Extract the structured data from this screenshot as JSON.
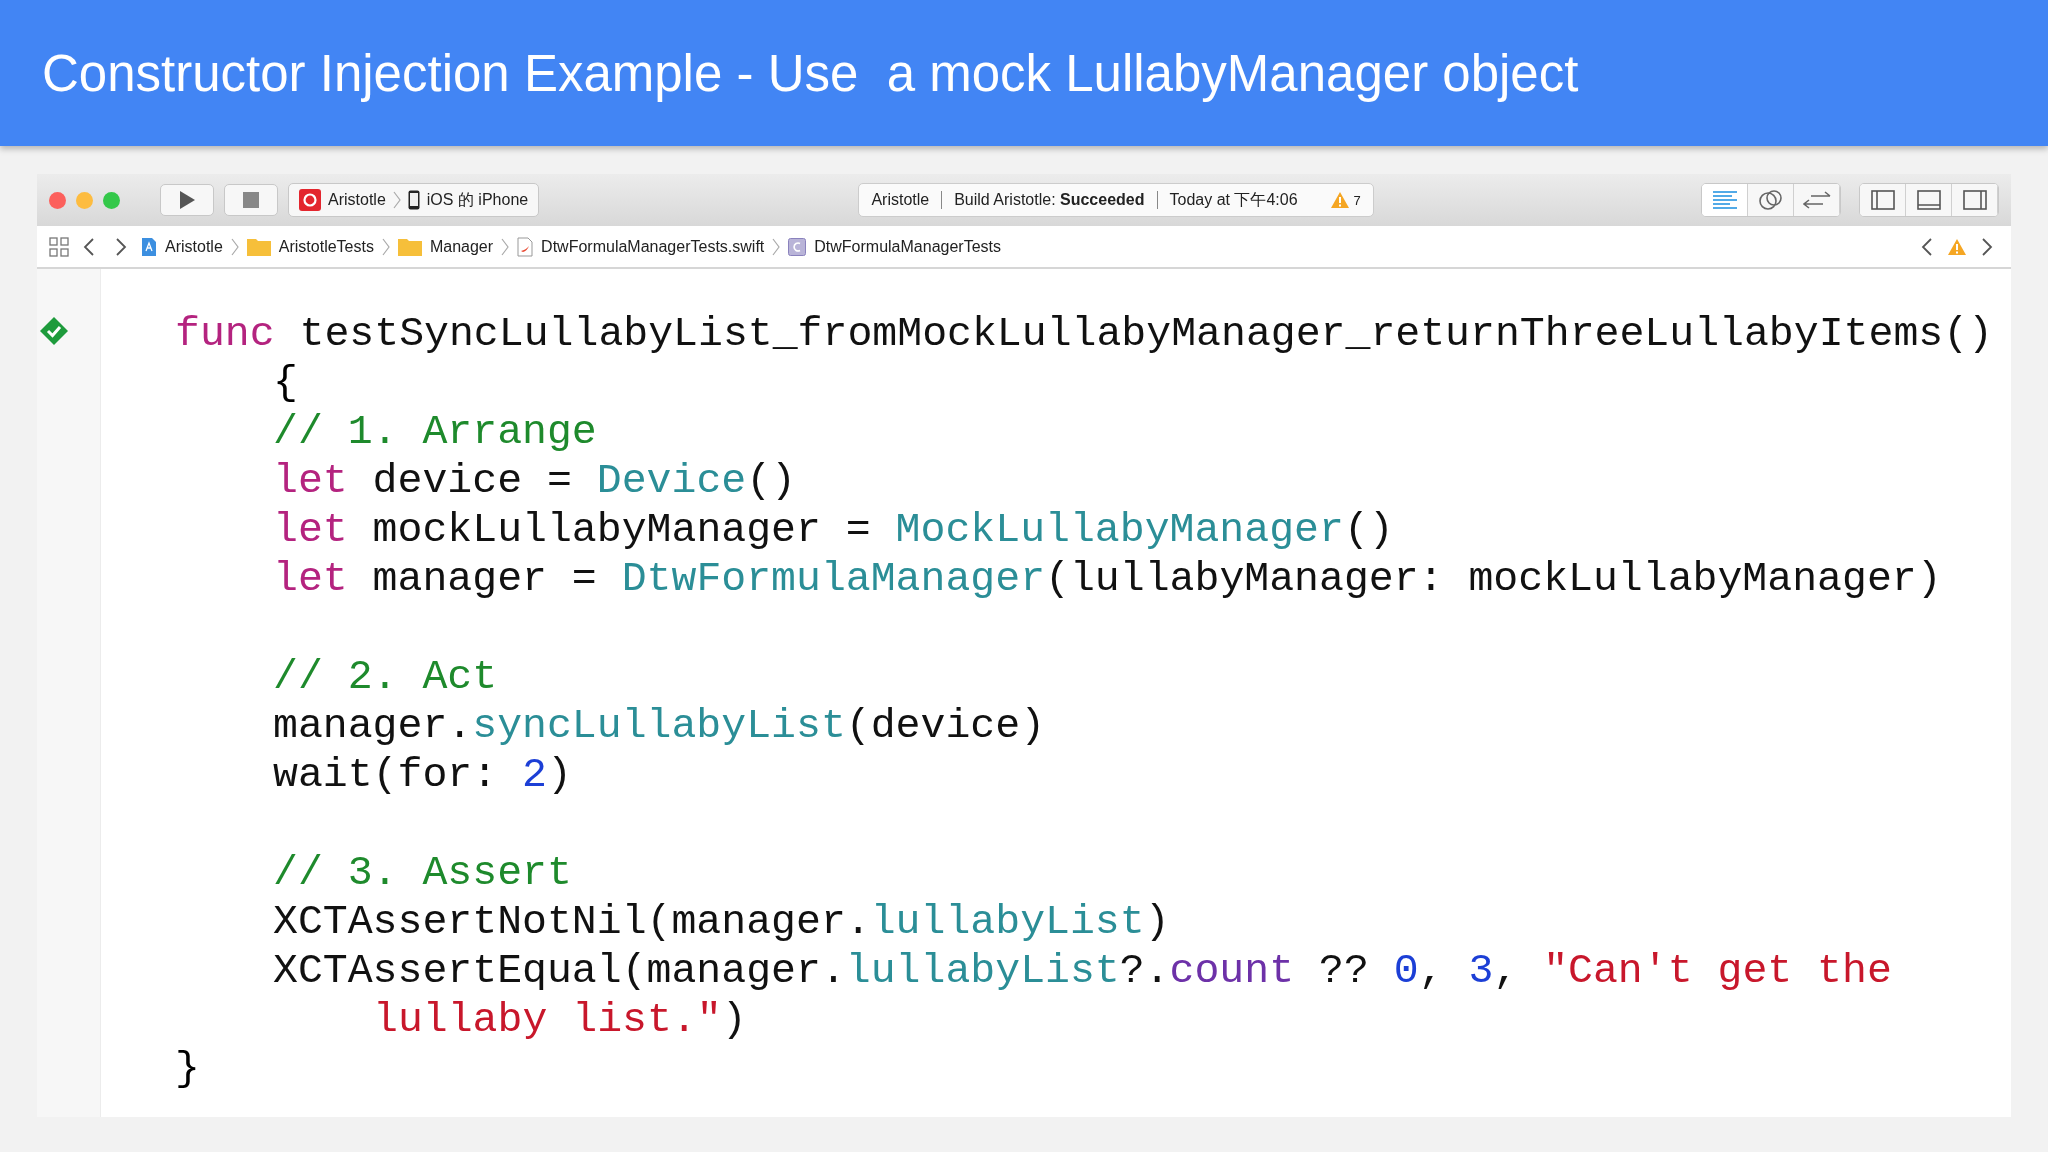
{
  "slide": {
    "title": "Constructor Injection Example - Use  a mock LullabyManager object"
  },
  "toolbar": {
    "scheme": {
      "target": "Aristotle",
      "device": "iOS 的 iPhone"
    },
    "activity": {
      "project": "Aristotle",
      "status": "Build Aristotle: **Succeeded**",
      "time": "Today at 下午4:06",
      "warnings": "7"
    },
    "editor_modes": [
      {
        "kind": "standard",
        "selected": true
      },
      {
        "kind": "assistant",
        "selected": false
      },
      {
        "kind": "version",
        "selected": false
      }
    ]
  },
  "jump_bar": {
    "items": [
      {
        "kind": "project",
        "label": "Aristotle"
      },
      {
        "kind": "folder",
        "label": "AristotleTests"
      },
      {
        "kind": "folder",
        "label": "Manager"
      },
      {
        "kind": "swift",
        "label": "DtwFormulaManagerTests.swift"
      },
      {
        "kind": "class",
        "label": "DtwFormulaManagerTests"
      }
    ]
  },
  "code": {
    "test_passed": true,
    "signature": [
      {
        "kind": "keyword",
        "text": "func"
      },
      {
        "kind": "plain",
        "text": " testSyncLullabyList_fromMockLullabyManager_returnThreeLullabyItems()"
      }
    ],
    "open_brace": "{",
    "blocks": [
      [
        {
          "kind": "statement",
          "tokens": [
            {
              "kind": "comment",
              "text": "// 1. Arrange"
            }
          ]
        },
        {
          "kind": "statement",
          "tokens": [
            {
              "kind": "keyword",
              "text": "let"
            },
            {
              "kind": "plain",
              "text": " device = "
            },
            {
              "kind": "type",
              "text": "Device"
            },
            {
              "kind": "plain",
              "text": "()"
            }
          ]
        },
        {
          "kind": "statement",
          "tokens": [
            {
              "kind": "keyword",
              "text": "let"
            },
            {
              "kind": "plain",
              "text": " mockLullabyManager = "
            },
            {
              "kind": "type",
              "text": "MockLullabyManager"
            },
            {
              "kind": "plain",
              "text": "()"
            }
          ]
        },
        {
          "kind": "statement",
          "tokens": [
            {
              "kind": "keyword",
              "text": "let"
            },
            {
              "kind": "plain",
              "text": " manager = "
            },
            {
              "kind": "type",
              "text": "DtwFormulaManager"
            },
            {
              "kind": "plain",
              "text": "(lullabyManager: mockLullabyManager)"
            }
          ]
        }
      ],
      [
        {
          "kind": "statement",
          "tokens": [
            {
              "kind": "comment",
              "text": "// 2. Act"
            }
          ]
        },
        {
          "kind": "statement",
          "tokens": [
            {
              "kind": "plain",
              "text": "manager."
            },
            {
              "kind": "type",
              "text": "syncLullabyList"
            },
            {
              "kind": "plain",
              "text": "(device)"
            }
          ]
        },
        {
          "kind": "statement",
          "tokens": [
            {
              "kind": "plain",
              "text": "wait(for: "
            },
            {
              "kind": "number",
              "text": "2"
            },
            {
              "kind": "plain",
              "text": ")"
            }
          ]
        }
      ],
      [
        {
          "kind": "statement",
          "tokens": [
            {
              "kind": "comment",
              "text": "// 3. Assert"
            }
          ]
        },
        {
          "kind": "statement",
          "tokens": [
            {
              "kind": "plain",
              "text": "XCTAssertNotNil(manager."
            },
            {
              "kind": "type",
              "text": "lullabyList"
            },
            {
              "kind": "plain",
              "text": ")"
            }
          ]
        },
        {
          "kind": "statement",
          "tokens": [
            {
              "kind": "plain",
              "text": "XCTAssertEqual(manager."
            },
            {
              "kind": "type",
              "text": "lullabyList"
            },
            {
              "kind": "plain",
              "text": "?."
            },
            {
              "kind": "member",
              "text": "count"
            },
            {
              "kind": "plain",
              "text": " ?? "
            },
            {
              "kind": "number",
              "text": "0"
            },
            {
              "kind": "plain",
              "text": ", "
            },
            {
              "kind": "number",
              "text": "3"
            },
            {
              "kind": "plain",
              "text": ", "
            },
            {
              "kind": "string",
              "text": "\"Can't get the"
            }
          ]
        },
        {
          "kind": "continuation",
          "tokens": [
            {
              "kind": "string",
              "text": "lullaby list.\""
            },
            {
              "kind": "plain",
              "text": ")"
            }
          ]
        }
      ]
    ],
    "close_brace": "}"
  }
}
